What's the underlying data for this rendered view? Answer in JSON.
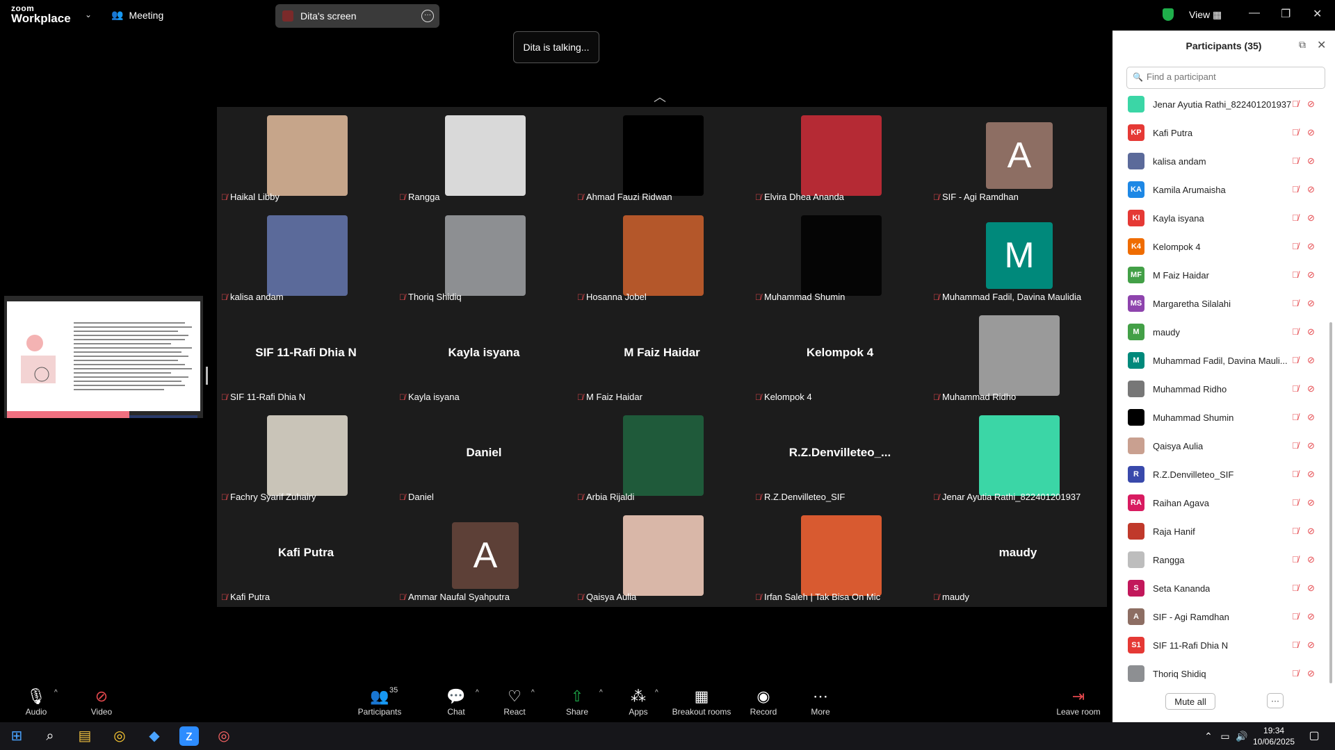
{
  "app": {
    "logo_line1": "zoom",
    "logo_line2": "Workplace",
    "meeting_label": "Meeting",
    "share_pill_label": "Dita's screen",
    "view_label": "View"
  },
  "talking_banner": "Dita is talking...",
  "grid": {
    "rows": [
      [
        {
          "caption": "Haikal Libby",
          "kind": "photo",
          "color": "#c6a58a"
        },
        {
          "caption": "Rangga",
          "kind": "photo",
          "color": "#d9d9d9"
        },
        {
          "caption": "Ahmad Fauzi Ridwan",
          "kind": "black",
          "color": "#000000"
        },
        {
          "caption": "Elvira Dhea Ananda",
          "kind": "photo",
          "color": "#b52a34"
        },
        {
          "caption": "SIF - Agi Ramdhan",
          "kind": "letter",
          "letter": "A",
          "color": "#8d6e63"
        }
      ],
      [
        {
          "caption": "kalisa andam",
          "kind": "photo",
          "color": "#5b6a9a"
        },
        {
          "caption": "Thoriq Shidiq",
          "kind": "photo",
          "color": "#8d8f92"
        },
        {
          "caption": "Hosanna Jobel",
          "kind": "photo",
          "color": "#b4572a"
        },
        {
          "caption": "Muhammad Shumin",
          "kind": "black",
          "color": "#050505"
        },
        {
          "caption": "Muhammad Fadil, Davina Maulidia",
          "kind": "letter",
          "letter": "M",
          "color": "#00897b"
        }
      ],
      [
        {
          "caption": "SIF 11-Rafi Dhia N",
          "kind": "name",
          "bigname": "SIF 11-Rafi Dhia N"
        },
        {
          "caption": "Kayla isyana",
          "kind": "name",
          "bigname": "Kayla isyana"
        },
        {
          "caption": "M Faiz Haidar",
          "kind": "name",
          "bigname": "M Faiz Haidar"
        },
        {
          "caption": "Kelompok 4",
          "kind": "name",
          "bigname": "Kelompok 4"
        },
        {
          "caption": "Muhammad Ridho",
          "kind": "photo",
          "color": "#9a9a9a"
        }
      ],
      [
        {
          "caption": "Fachry Syarif Zuhairy",
          "kind": "photo",
          "color": "#c9c4b8"
        },
        {
          "caption": "Daniel",
          "kind": "name",
          "bigname": "Daniel"
        },
        {
          "caption": "Arbia Rijaldi",
          "kind": "photo",
          "color": "#1f5a3a"
        },
        {
          "caption": "R.Z.Denvilleteo_SIF",
          "kind": "name",
          "bigname": "R.Z.Denvilleteo_..."
        },
        {
          "caption": "Jenar Ayutia Rathi_822401201937",
          "kind": "photo",
          "color": "#3bd6a6"
        }
      ],
      [
        {
          "caption": "Kafi Putra",
          "kind": "name",
          "bigname": "Kafi Putra"
        },
        {
          "caption": "Ammar Naufal Syahputra",
          "kind": "letter",
          "letter": "A",
          "color": "#5d4037"
        },
        {
          "caption": "Qaisya Aulia",
          "kind": "photo",
          "color": "#d9b7a8"
        },
        {
          "caption": "Irfan Saleh | Tak Bisa On Mic",
          "kind": "photo",
          "color": "#d85a30"
        },
        {
          "caption": "maudy",
          "kind": "name",
          "bigname": "maudy"
        }
      ]
    ]
  },
  "sidebar": {
    "title": "Participants (35)",
    "search_placeholder": "Find a participant",
    "participants": [
      {
        "name": "Jenar Ayutia Rathi_822401201937",
        "initials": "",
        "color": "#3bd6a6"
      },
      {
        "name": "Kafi Putra",
        "initials": "KP",
        "color": "#e53935"
      },
      {
        "name": "kalisa andam",
        "initials": "",
        "color": "#5b6a9a"
      },
      {
        "name": "Kamila Arumaisha",
        "initials": "KA",
        "color": "#1e88e5"
      },
      {
        "name": "Kayla isyana",
        "initials": "KI",
        "color": "#e53935"
      },
      {
        "name": "Kelompok 4",
        "initials": "K4",
        "color": "#ef6c00"
      },
      {
        "name": "M Faiz Haidar",
        "initials": "MF",
        "color": "#43a047"
      },
      {
        "name": "Margaretha Silalahi",
        "initials": "MS",
        "color": "#8e44ad"
      },
      {
        "name": "maudy",
        "initials": "M",
        "color": "#43a047"
      },
      {
        "name": "Muhammad Fadil, Davina Mauli...",
        "initials": "M",
        "color": "#00897b"
      },
      {
        "name": "Muhammad Ridho",
        "initials": "",
        "color": "#777777"
      },
      {
        "name": "Muhammad Shumin",
        "initials": "",
        "color": "#000000"
      },
      {
        "name": "Qaisya Aulia",
        "initials": "",
        "color": "#c9a090"
      },
      {
        "name": "R.Z.Denvilleteo_SIF",
        "initials": "R",
        "color": "#3949ab"
      },
      {
        "name": "Raihan Agava",
        "initials": "RA",
        "color": "#d81b60"
      },
      {
        "name": "Raja Hanif",
        "initials": "",
        "color": "#c0392b"
      },
      {
        "name": "Rangga",
        "initials": "",
        "color": "#bdbdbd"
      },
      {
        "name": "Seta Kananda",
        "initials": "S",
        "color": "#c2185b"
      },
      {
        "name": "SIF - Agi Ramdhan",
        "initials": "A",
        "color": "#8d6e63"
      },
      {
        "name": "SIF 11-Rafi Dhia N",
        "initials": "S1",
        "color": "#e53935"
      },
      {
        "name": "Thoriq Shidiq",
        "initials": "",
        "color": "#8d8f92"
      }
    ],
    "mute_all": "Mute all"
  },
  "toolbar": {
    "audio": "Audio",
    "video": "Video",
    "participants": "Participants",
    "participants_count": "35",
    "chat": "Chat",
    "react": "React",
    "share": "Share",
    "apps": "Apps",
    "breakout": "Breakout rooms",
    "record": "Record",
    "more": "More",
    "leave": "Leave room"
  },
  "taskbar": {
    "time": "19:34",
    "date": "10/06/2025"
  }
}
